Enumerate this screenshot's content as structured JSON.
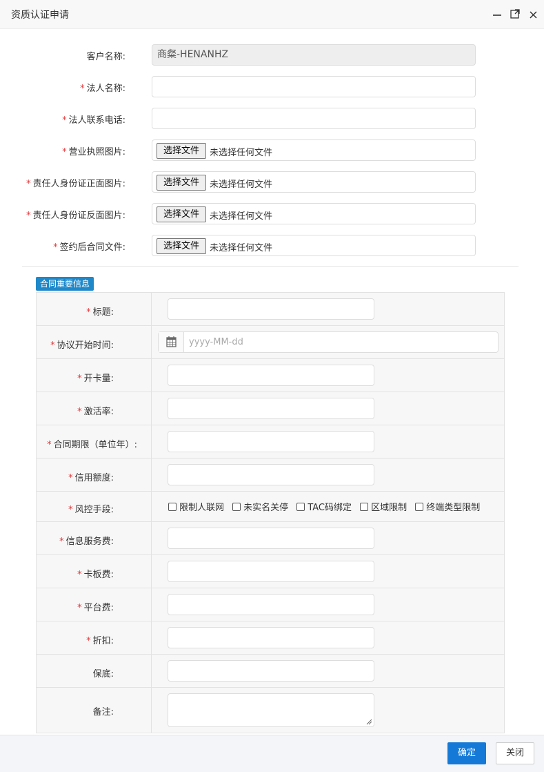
{
  "window": {
    "title": "资质认证申请",
    "minimize_icon": "minimize-icon",
    "maximize_icon": "maximize-icon",
    "close_icon": "close-icon"
  },
  "form": {
    "customer": {
      "label": "客户名称:",
      "value": "商粲-HENANHZ"
    },
    "legal_name": {
      "required": "*",
      "label": "法人名称:",
      "value": ""
    },
    "legal_phone": {
      "required": "*",
      "label": "法人联系电话:",
      "value": ""
    },
    "business_license": {
      "required": "*",
      "label": "营业执照图片:"
    },
    "id_front": {
      "required": "*",
      "label": "责任人身份证正面图片:"
    },
    "id_back": {
      "required": "*",
      "label": "责任人身份证反面图片:"
    },
    "contract_file": {
      "required": "*",
      "label": "签约后合同文件:"
    },
    "file_button": "选择文件",
    "file_none": "未选择任何文件"
  },
  "contract": {
    "section_title": "合同重要信息",
    "title": {
      "required": "*",
      "label": "标题:"
    },
    "start_date": {
      "required": "*",
      "label": "协议开始时间:",
      "placeholder": "yyyy-MM-dd",
      "icon": "calendar-icon"
    },
    "card_count": {
      "required": "*",
      "label": "开卡量:"
    },
    "activation_rate": {
      "required": "*",
      "label": "激活率:"
    },
    "term": {
      "required": "*",
      "label": "合同期限（单位年）:"
    },
    "credit": {
      "required": "*",
      "label": "信用额度:"
    },
    "risk": {
      "required": "*",
      "label": "风控手段:",
      "options": [
        "限制人联网",
        "未实名关停",
        "TAC码绑定",
        "区域限制",
        "终端类型限制"
      ]
    },
    "service_fee": {
      "required": "*",
      "label": "信息服务费:"
    },
    "card_board_fee": {
      "required": "*",
      "label": "卡板费:"
    },
    "platform_fee": {
      "required": "*",
      "label": "平台费:"
    },
    "discount": {
      "required": "*",
      "label": "折扣:"
    },
    "guarantee": {
      "label": "保底:"
    },
    "remark": {
      "label": "备注:"
    }
  },
  "footer": {
    "ok": "确定",
    "close": "关闭"
  }
}
